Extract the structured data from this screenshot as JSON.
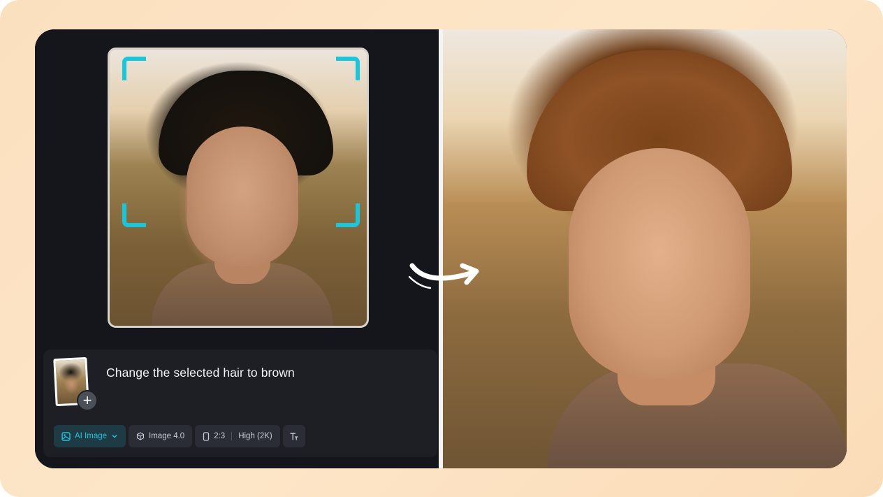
{
  "prompt": {
    "text": "Change the selected hair to brown",
    "add_reference_symbol": "+"
  },
  "toolbar": {
    "mode_label": "AI Image",
    "model_label": "Image 4.0",
    "aspect_ratio": "2:3",
    "quality": "High (2K)"
  },
  "icons": {
    "mode": "ai-image-icon",
    "mode_dropdown": "chevron-down-icon",
    "model": "cube-icon",
    "aspect": "phone-portrait-icon",
    "text_style": "text-size-icon",
    "transform": "curved-arrow-right-icon"
  },
  "colors": {
    "accent": "#19c6dc",
    "panel_bg": "#15161b",
    "frame_bg": "#fde6c8"
  }
}
